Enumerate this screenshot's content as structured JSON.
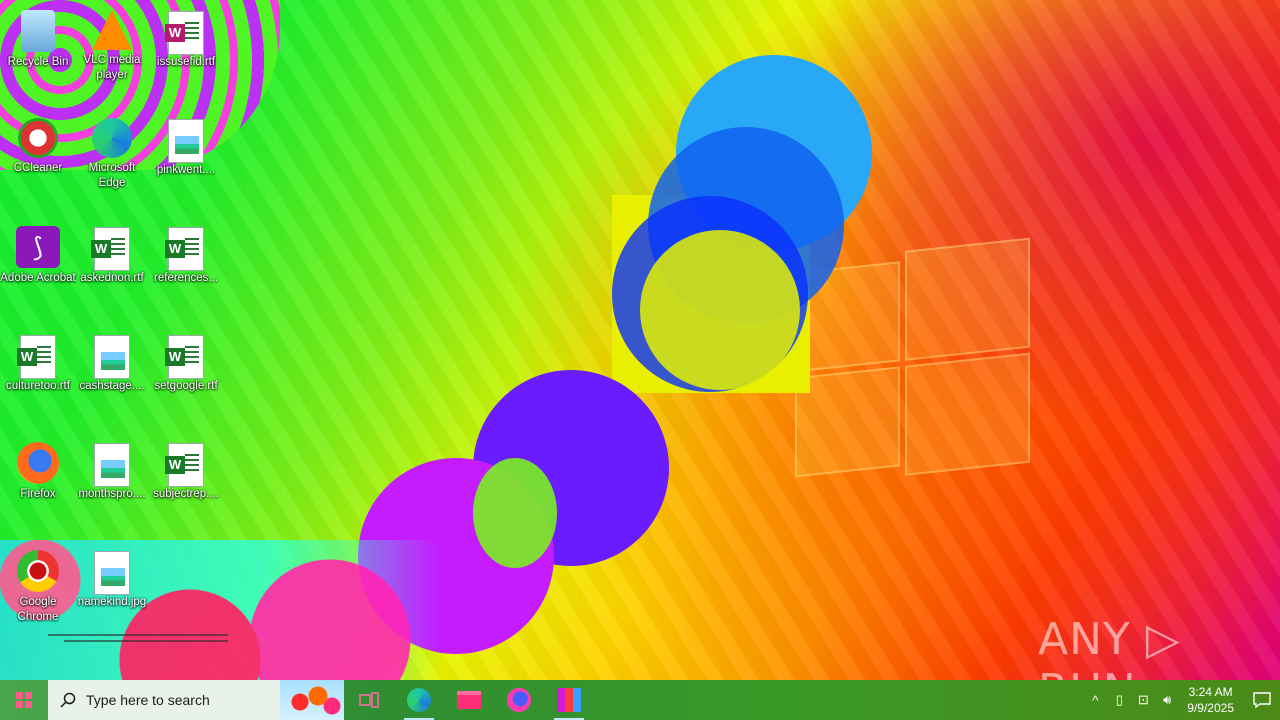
{
  "desktop": {
    "icons": [
      {
        "name": "recycle-bin",
        "label": "Recycle Bin",
        "kind": "bin"
      },
      {
        "name": "vlc",
        "label": "VLC media player",
        "kind": "vlc"
      },
      {
        "name": "fil-issuse",
        "label": "issusefid.rtf",
        "kind": "rtf"
      },
      {
        "name": "ccleaner",
        "label": "CCleaner",
        "kind": "app"
      },
      {
        "name": "edge",
        "label": "Microsoft Edge",
        "kind": "edge"
      },
      {
        "name": "pinkwent",
        "label": "pinkwent....",
        "kind": "img"
      },
      {
        "name": "adobe",
        "label": "Adobe Acrobat",
        "kind": "acrobat"
      },
      {
        "name": "askednon",
        "label": "askednon.rtf",
        "kind": "rtf"
      },
      {
        "name": "references",
        "label": "references...",
        "kind": "rtf"
      },
      {
        "name": "culturetoo",
        "label": "culturetoo.rtf",
        "kind": "rtf"
      },
      {
        "name": "cashstage",
        "label": "cashstage....",
        "kind": "img"
      },
      {
        "name": "setgoogle",
        "label": "setgoogle.rtf",
        "kind": "rtf"
      },
      {
        "name": "firefox",
        "label": "Firefox",
        "kind": "firefox"
      },
      {
        "name": "monthspro",
        "label": "monthspro....",
        "kind": "img"
      },
      {
        "name": "subjectrep",
        "label": "subjectrep....",
        "kind": "rtf"
      },
      {
        "name": "google-chrome",
        "label": "Google Chrome",
        "kind": "chrome"
      },
      {
        "name": "namekind",
        "label": "namekind.jpg",
        "kind": "img"
      }
    ],
    "watermark": "ANY ▷ RUN"
  },
  "taskbar": {
    "search_placeholder": "Type here to search",
    "apps": [
      "task-view",
      "edge",
      "file-explorer",
      "firefox",
      "winrar"
    ],
    "clock_time": "3:24 AM",
    "clock_date": "9/9/2025"
  },
  "colors": {
    "taskbar": "#2f8d31",
    "start_logo": "#ff5b8a"
  }
}
